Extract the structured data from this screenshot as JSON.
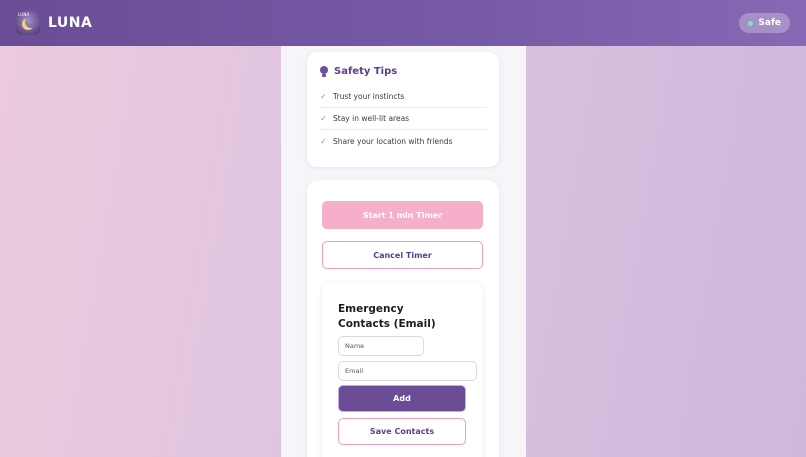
{
  "header": {
    "logo_text": "LUNA",
    "app_name": "LUNA",
    "status_label": "Safe"
  },
  "safety_tips": {
    "title": "Safety Tips",
    "items": [
      {
        "text": "Trust your instincts"
      },
      {
        "text": "Stay in well-lit areas"
      },
      {
        "text": "Share your location with friends"
      }
    ]
  },
  "timer": {
    "start_label": "Start 1 min Timer",
    "cancel_label": "Cancel Timer"
  },
  "contacts": {
    "title": "Emergency Contacts (Email)",
    "name_placeholder": "Name",
    "email_placeholder": "Email",
    "add_label": "Add",
    "save_label": "Save Contacts"
  },
  "colors": {
    "header": "#6a4d96",
    "accent": "#5b3f8a",
    "pink": "#f5afca",
    "safe": "#7fe3c6",
    "check": "#4fc08d"
  }
}
